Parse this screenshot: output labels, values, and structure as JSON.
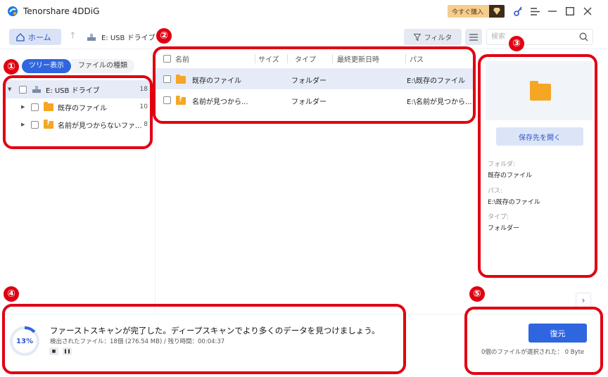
{
  "titlebar": {
    "app_title": "Tenorshare 4DDiG",
    "buy_label": "今すぐ購入",
    "icons": [
      "logo-icon",
      "gem-icon",
      "key-icon",
      "menu-icon",
      "minimize-icon",
      "maximize-icon",
      "close-icon"
    ]
  },
  "toolbar": {
    "home_label": "ホーム",
    "crumb": "E: USB ドライブ",
    "filter_label": "フィルタ",
    "search_placeholder": "検索"
  },
  "sidebar": {
    "tabs": [
      "ツリー表示",
      "ファイルの種類"
    ],
    "tree": [
      {
        "label": "E: USB ドライブ",
        "count": "18"
      },
      {
        "label": "既存のファイル",
        "count": "10"
      },
      {
        "label": "名前が見つからないファ...",
        "count": "8"
      }
    ]
  },
  "table": {
    "headers": [
      "名前",
      "サイズ",
      "タイプ",
      "最終更新日時",
      "パス"
    ],
    "rows": [
      {
        "name": "既存のファイル",
        "size": "",
        "type": "フォルダー",
        "date": "",
        "path": "E:\\既存のファイル"
      },
      {
        "name": "名前が見つから...",
        "size": "",
        "type": "フォルダー",
        "date": "",
        "path": "E:\\名前が見つから..."
      }
    ]
  },
  "details": {
    "open_label": "保存先を開く",
    "folder_label": "フォルダ:",
    "folder_value": "既存のファイル",
    "path_label": "パス:",
    "path_value": "E:\\既存のファイル",
    "type_label": "タイプ:",
    "type_value": "フォルダー"
  },
  "status": {
    "progress_percent": "13%",
    "progress": 0.13,
    "message": "ファーストスキャンが完了した。ディープスキャンでより多くのデータを見つけましょう。",
    "detail": "検出されたファイル：18個 (276.54 MB) /  残り時間：00:04:37",
    "restore_label": "復元",
    "selection_info": "0個のファイルが選択された： 0 Byte"
  },
  "annotations": [
    "①",
    "②",
    "③",
    "④",
    "⑤"
  ],
  "colors": {
    "accent": "#2f66e0",
    "annotation": "#e00012",
    "folder": "#f5a623",
    "selected_row": "#e6ebf7"
  }
}
